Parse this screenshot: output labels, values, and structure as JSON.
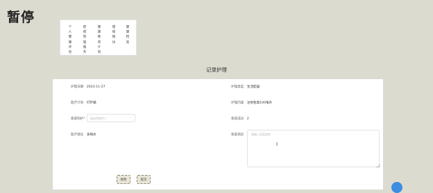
{
  "status": {
    "title": "暂停"
  },
  "tabs": [
    [
      "个",
      "人",
      "健",
      "康",
      "评",
      "估"
    ],
    [
      "疾",
      "病",
      "管",
      "理",
      "服",
      "务"
    ],
    [
      "健",
      "康",
      "教",
      "育",
      "计",
      "划"
    ],
    [
      "慢",
      "病",
      "随",
      "访"
    ],
    [
      "健",
      "康",
      "档",
      "案"
    ]
  ],
  "section": {
    "title": "记录护理"
  },
  "form": {
    "care_date": {
      "label": "护理日期",
      "value": "2023-11-27"
    },
    "care_type": {
      "label": "护理类型",
      "value": "生活起居"
    },
    "plan": {
      "label": "医疗计划",
      "value": "打针输"
    },
    "content": {
      "label": "护理内容",
      "value": "注射各类100毫升"
    },
    "caregiver": {
      "label": "家庭照护",
      "placeholder": "请选择照护人"
    },
    "frequency": {
      "label": "家庭成员",
      "value": "2"
    },
    "assessment": {
      "label": "医疗建议",
      "value": "多喝水"
    },
    "remarks": {
      "label": "家庭病房",
      "placeholder": "请输入家庭病房"
    }
  },
  "buttons": {
    "edit": "修改",
    "save": "提交"
  },
  "colors": {
    "background": "#dcdbd0",
    "panel": "#ffffff",
    "accent": "#3f8de0"
  }
}
